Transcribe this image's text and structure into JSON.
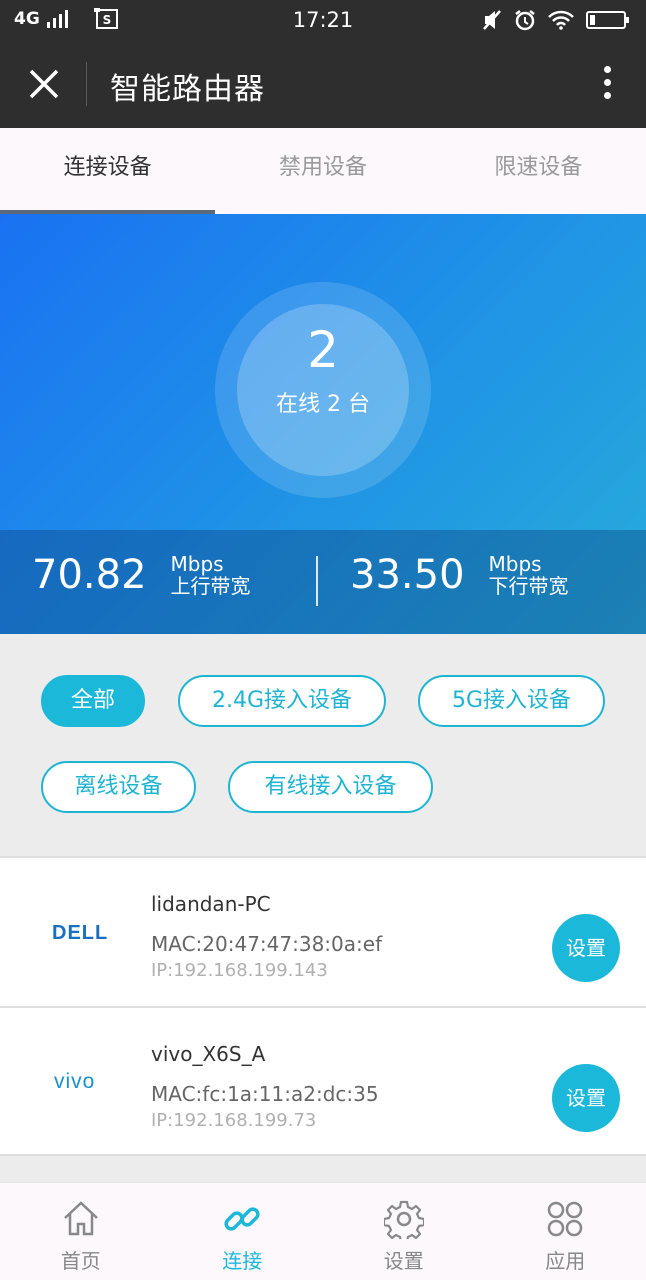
{
  "status_bar": {
    "network": "4G",
    "time": "17:21"
  },
  "titlebar": {
    "title": "智能路由器"
  },
  "tabs": [
    {
      "label": "连接设备",
      "active": true
    },
    {
      "label": "禁用设备",
      "active": false
    },
    {
      "label": "限速设备",
      "active": false
    }
  ],
  "hero": {
    "online_count": "2",
    "online_text": "在线 2 台",
    "upload": {
      "value": "70.82",
      "unit": "Mbps",
      "label": "上行带宽"
    },
    "download": {
      "value": "33.50",
      "unit": "Mbps",
      "label": "下行带宽"
    }
  },
  "filters": [
    {
      "label": "全部",
      "active": true
    },
    {
      "label": "2.4G接入设备",
      "active": false
    },
    {
      "label": "5G接入设备",
      "active": false
    },
    {
      "label": "离线设备",
      "active": false
    },
    {
      "label": "有线接入设备",
      "active": false
    }
  ],
  "devices": [
    {
      "name": "lidandan-PC",
      "mac": "MAC:20:47:47:38:0a:ef",
      "ip": "IP:192.168.199.143",
      "logo_text": "DELL",
      "button": "设置"
    },
    {
      "name": "vivo_X6S_A",
      "mac": "MAC:fc:1a:11:a2:dc:35",
      "ip": "IP:192.168.199.73",
      "logo_text": "vivo",
      "button": "设置"
    }
  ],
  "bottom_nav": [
    {
      "label": "首页",
      "icon": "home-icon",
      "active": false
    },
    {
      "label": "连接",
      "icon": "link-icon",
      "active": true
    },
    {
      "label": "设置",
      "icon": "gear-icon",
      "active": false
    },
    {
      "label": "应用",
      "icon": "apps-icon",
      "active": false
    }
  ],
  "colors": {
    "accent": "#1cb8d9",
    "titlebar": "#2e2e2e",
    "hero_start": "#1a72f2",
    "hero_end": "#27acd9"
  }
}
